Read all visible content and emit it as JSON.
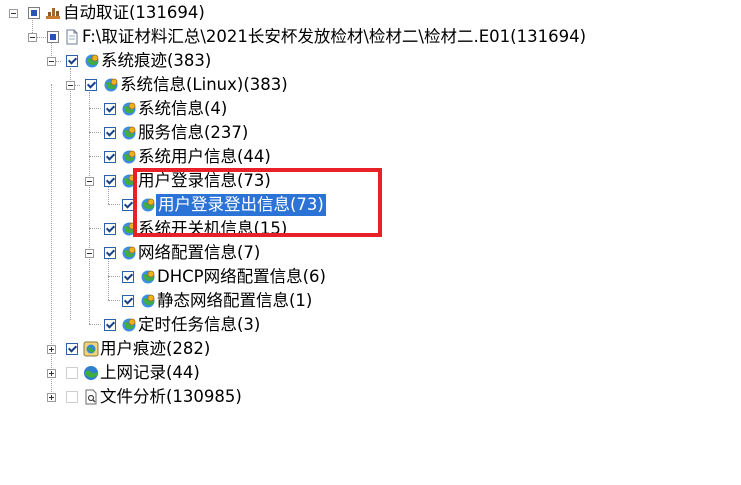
{
  "tree": {
    "root": {
      "label": "自动取证(131694)",
      "check": "partial",
      "icon": "stack-icon"
    },
    "case": {
      "label": "F:\\取证材料汇总\\2021长安杯发放检材\\检材二\\检材二.E01(131694)",
      "check": "partial",
      "icon": "document-icon"
    },
    "system_traces": {
      "label": "系统痕迹(383)",
      "check": "checked",
      "icon": "globe-gear-icon"
    },
    "system_info_linux": {
      "label": "系统信息(Linux)(383)",
      "check": "checked",
      "icon": "globe-gear-icon"
    },
    "system_info": {
      "label": "系统信息(4)",
      "check": "checked",
      "icon": "globe-gear-icon"
    },
    "service_info": {
      "label": "服务信息(237)",
      "check": "checked",
      "icon": "globe-gear-icon"
    },
    "system_user_info": {
      "label": "系统用户信息(44)",
      "check": "checked",
      "icon": "globe-gear-icon"
    },
    "user_login_info": {
      "label": "用户登录信息(73)",
      "check": "checked",
      "icon": "globe-gear-icon"
    },
    "user_login_logout_info": {
      "label": "用户登录登出信息(73)",
      "check": "checked",
      "icon": "globe-gear-icon",
      "selected": true
    },
    "system_power_info": {
      "label": "系统开关机信息(15)",
      "check": "checked",
      "icon": "globe-gear-icon"
    },
    "network_config_info": {
      "label": "网络配置信息(7)",
      "check": "checked",
      "icon": "globe-gear-icon"
    },
    "dhcp_network_config_info": {
      "label": "DHCP网络配置信息(6)",
      "check": "checked",
      "icon": "globe-gear-icon"
    },
    "static_network_config_info": {
      "label": "静态网络配置信息(1)",
      "check": "checked",
      "icon": "globe-gear-icon"
    },
    "scheduled_task_info": {
      "label": "定时任务信息(3)",
      "check": "checked",
      "icon": "globe-gear-icon"
    },
    "user_traces": {
      "label": "用户痕迹(282)",
      "check": "checked",
      "icon": "monitor-globe-icon"
    },
    "internet_records": {
      "label": "上网记录(44)",
      "check": "unchecked",
      "icon": "globe-icon"
    },
    "file_analysis": {
      "label": "文件分析(130985)",
      "check": "unchecked",
      "icon": "file-search-icon"
    }
  },
  "colors": {
    "selection": "#2b73d6",
    "highlight_box": "#e8202a"
  }
}
